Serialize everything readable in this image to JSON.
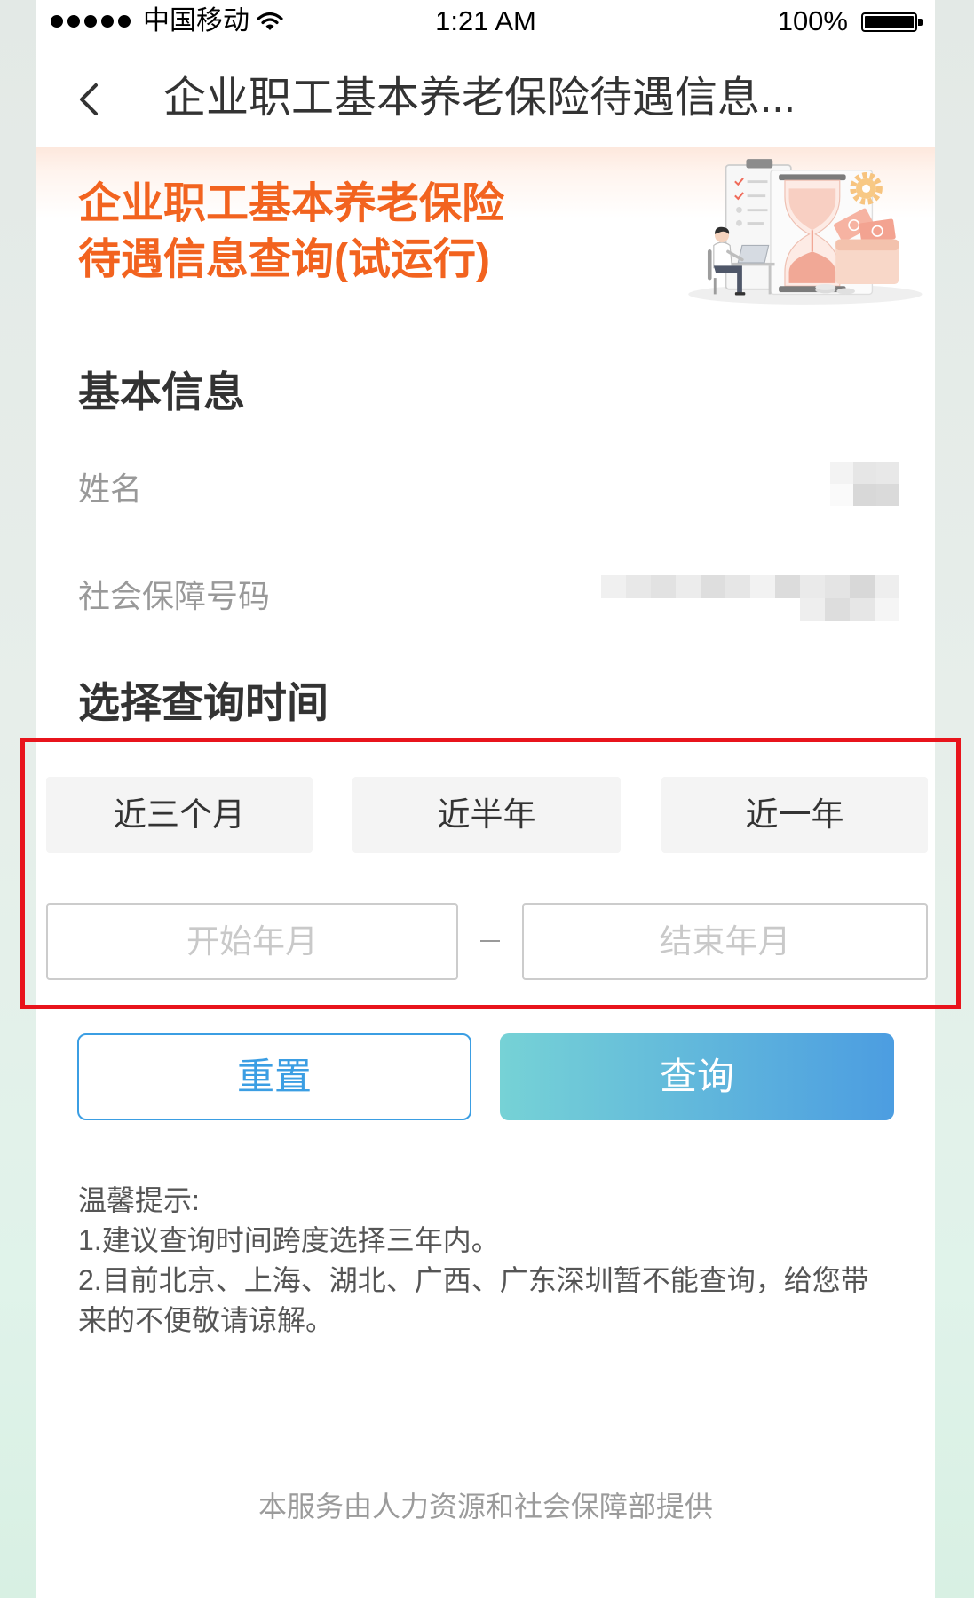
{
  "status_bar": {
    "signal_strength": 5,
    "carrier": "中国移动",
    "time": "1:21 AM",
    "battery_text": "100%",
    "battery_level": 1
  },
  "nav": {
    "back_icon": "chevron-left-icon",
    "title": "企业职工基本养老保险待遇信息..."
  },
  "banner": {
    "title_lines": [
      "企业职工基本养老保险",
      "待遇信息查询(试运行)"
    ]
  },
  "basic_info": {
    "heading": "基本信息",
    "fields": [
      {
        "label": "姓名"
      },
      {
        "label": "社会保障号码"
      }
    ]
  },
  "query_time": {
    "heading": "选择查询时间",
    "periods": [
      "近三个月",
      "近半年",
      "近一年"
    ],
    "start_placeholder": "开始年月",
    "end_placeholder": "结束年月"
  },
  "actions": {
    "reset": "重置",
    "query": "查询"
  },
  "tips": {
    "lines": [
      "温馨提示:",
      "1.建议查询时间跨度选择三年内。",
      "2.目前北京、上海、湖北、广西、广东深圳暂不能查询，给您带",
      "来的不便敬请谅解。"
    ]
  },
  "footer": "本服务由人力资源和社会保障部提供",
  "colors": {
    "accent_orange": "#f2631f",
    "primary_blue": "#3b9ee3",
    "highlight_red": "#e8141c",
    "query_gradient_start": "#76d2d6",
    "query_gradient_end": "#4c9de1"
  }
}
